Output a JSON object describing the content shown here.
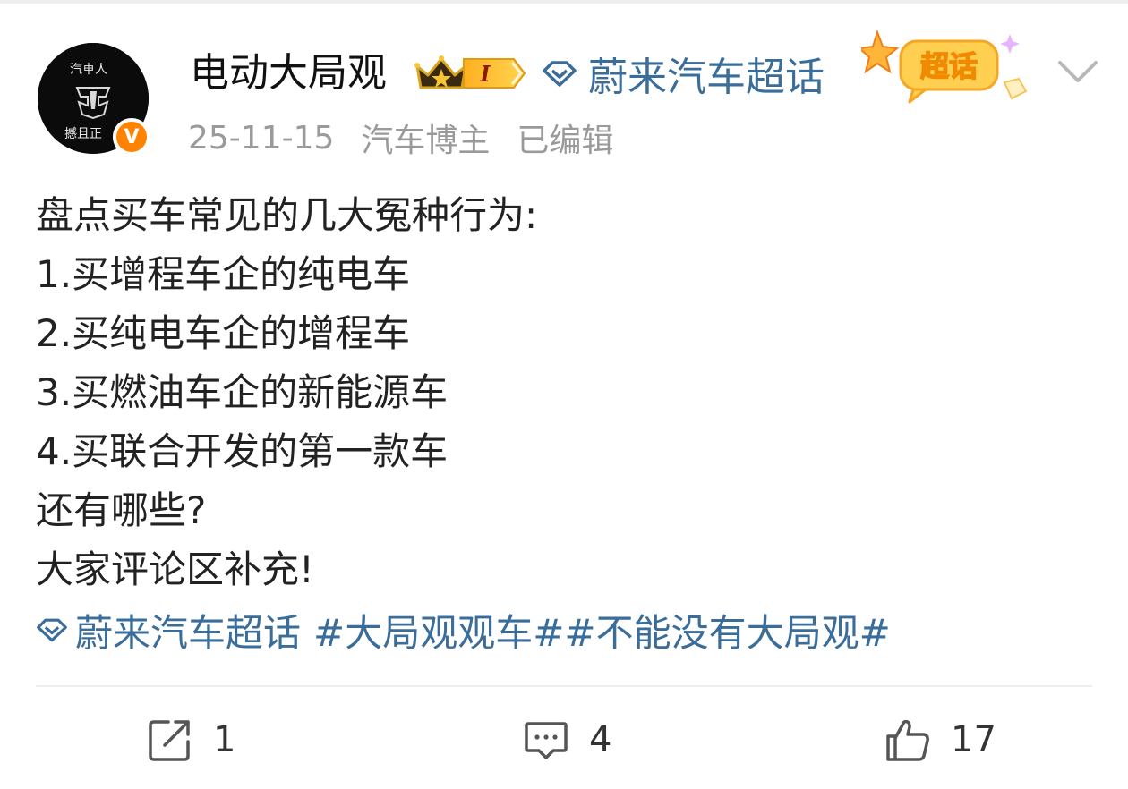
{
  "user": {
    "name": "电动大局观",
    "level": "I",
    "verified_mark": "V",
    "avatar_text": [
      "汽車人",
      "撼且正"
    ]
  },
  "topic": {
    "label": "蔚来汽车超话",
    "sticker_text": "超话"
  },
  "meta": {
    "date": "25-11-15",
    "role": "汽车博主",
    "edited": "已编辑"
  },
  "post": {
    "lines": [
      "盘点买车常见的几大冤种行为:",
      "1.买增程车企的纯电车",
      "2.买纯电车企的增程车",
      "3.买燃油车企的新能源车",
      "4.买联合开发的第一款车",
      "还有哪些?",
      "大家评论区补充!"
    ],
    "tags": {
      "topic": "蔚来汽车超话",
      "hashtag1": "#大局观观车#",
      "hashtag2": "#不能没有大局观#"
    }
  },
  "actions": {
    "repost_count": "1",
    "comment_count": "4",
    "like_count": "17"
  },
  "colors": {
    "link": "#3a6d9a",
    "verified": "#ff8200",
    "meta": "#9a9a9a"
  }
}
